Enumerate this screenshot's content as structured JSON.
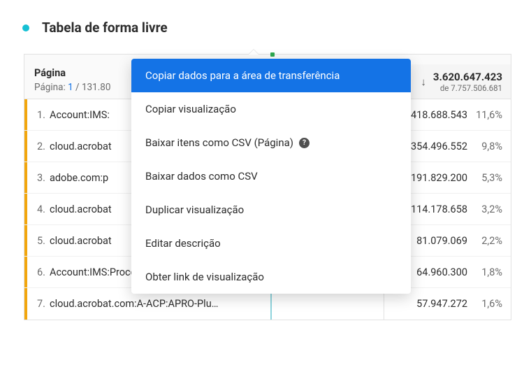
{
  "title": "Tabela de forma livre",
  "header": {
    "dimension_label": "Página",
    "paging_prefix": "Página:",
    "paging_current": "1",
    "paging_sep": "/",
    "paging_total": "131.80",
    "metric_value": "3.620.647.423",
    "metric_sub_prefix": "de",
    "metric_sub_value": "7.757.506.681"
  },
  "rows": [
    {
      "n": "1.",
      "label": "Account:IMS:",
      "value": "418.688.543",
      "pct": "11,6%"
    },
    {
      "n": "2.",
      "label": "cloud.acrobat",
      "value": "354.496.552",
      "pct": "9,8%"
    },
    {
      "n": "3.",
      "label": "adobe.com:p",
      "value": "191.829.200",
      "pct": "5,3%"
    },
    {
      "n": "4.",
      "label": "cloud.acrobat",
      "value": "114.178.658",
      "pct": "3,2%"
    },
    {
      "n": "5.",
      "label": "cloud.acrobat",
      "value": "81.079.069",
      "pct": "2,2%"
    },
    {
      "n": "6.",
      "label": "Account:IMS:Process:Complete",
      "value": "64.960.300",
      "pct": "1,8%"
    },
    {
      "n": "7.",
      "label": "cloud.acrobat.com:A-ACP:APRO-Plu…",
      "value": "57.947.272",
      "pct": "1,6%"
    }
  ],
  "menu": {
    "copy_clipboard": "Copiar dados para a área de transferência",
    "copy_viz": "Copiar visualização",
    "download_items_csv": "Baixar itens como CSV (Página)",
    "download_data_csv": "Baixar dados como CSV",
    "duplicate_viz": "Duplicar visualização",
    "edit_desc": "Editar descrição",
    "get_link": "Obter link de visualização",
    "help_glyph": "?"
  }
}
